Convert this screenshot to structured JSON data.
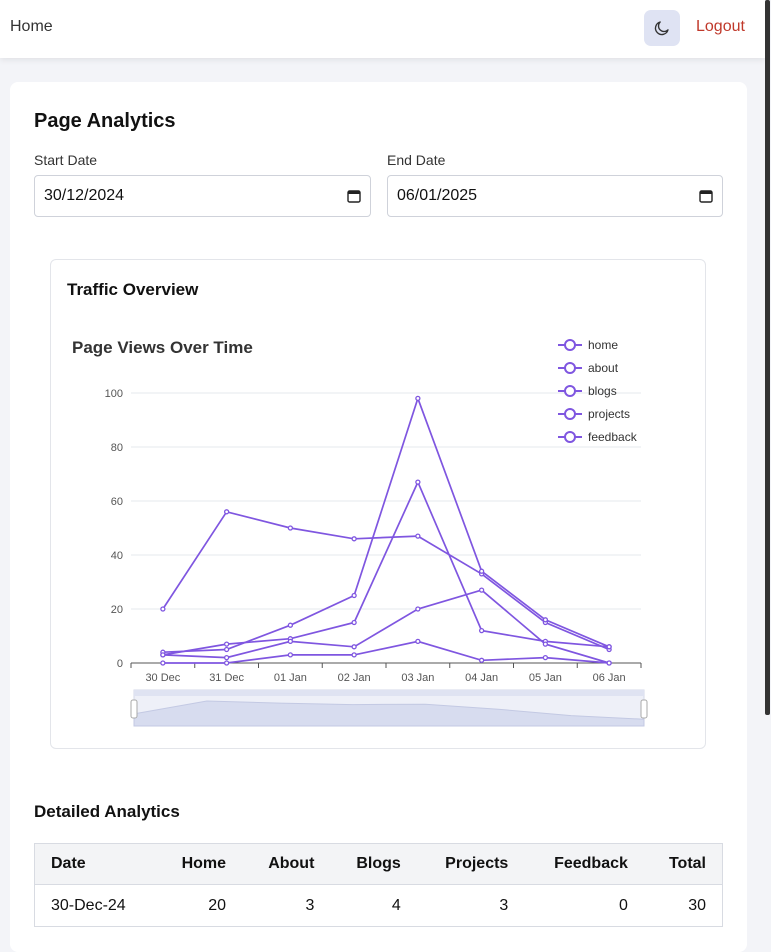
{
  "header": {
    "home_label": "Home",
    "theme_icon": "moon-icon",
    "logout_label": "Logout",
    "logout_color": "#c0392b"
  },
  "analytics": {
    "title": "Page Analytics",
    "start_label": "Start Date",
    "start_value": "30/12/2024",
    "end_label": "End Date",
    "end_value": "06/01/2025"
  },
  "overview": {
    "title": "Traffic Overview"
  },
  "chart_data": {
    "type": "line",
    "title": "Page Views Over Time",
    "categories": [
      "30 Dec",
      "31 Dec",
      "01 Jan",
      "02 Jan",
      "03 Jan",
      "04 Jan",
      "05 Jan",
      "06 Jan"
    ],
    "ylim": [
      0,
      100
    ],
    "yticks": [
      0,
      20,
      40,
      60,
      80,
      100
    ],
    "grid": true,
    "legend_position": "top-right",
    "series_color": "#7f56e0",
    "series": [
      {
        "name": "home",
        "values": [
          20,
          56,
          50,
          46,
          47,
          33,
          15,
          5
        ]
      },
      {
        "name": "about",
        "values": [
          3,
          7,
          9,
          15,
          67,
          12,
          8,
          6
        ]
      },
      {
        "name": "blogs",
        "values": [
          4,
          5,
          14,
          25,
          98,
          34,
          16,
          6
        ]
      },
      {
        "name": "projects",
        "values": [
          3,
          2,
          8,
          6,
          20,
          27,
          7,
          0
        ]
      },
      {
        "name": "feedback",
        "values": [
          0,
          0,
          3,
          3,
          8,
          1,
          2,
          0
        ]
      }
    ],
    "data_zoom": true
  },
  "detailed": {
    "title": "Detailed Analytics",
    "columns": [
      "Date",
      "Home",
      "About",
      "Blogs",
      "Projects",
      "Feedback",
      "Total"
    ],
    "rows": [
      [
        "30-Dec-24",
        "20",
        "3",
        "4",
        "3",
        "0",
        "30"
      ]
    ]
  }
}
